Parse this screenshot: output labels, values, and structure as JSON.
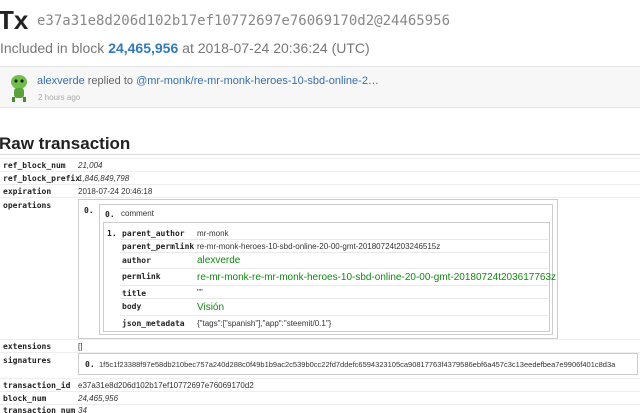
{
  "header": {
    "title": "Tx",
    "hash": "e37a31e8d206d102b17ef10772697e76069170d2",
    "at_sep": "@",
    "block_suffix": "24465956",
    "included_prefix": "Included in block",
    "block_number": "24,465,956",
    "included_at": "at 2018-07-24 20:36:24 (UTC)"
  },
  "activity": {
    "user": "alexverde",
    "action": "replied to",
    "target": "@mr-monk/re-mr-monk-heroes-10-sbd-online-2…",
    "time": "2 hours ago"
  },
  "raw": {
    "section_title": "Raw transaction",
    "ref_block_num_key": "ref_block_num",
    "ref_block_num": "21,004",
    "ref_block_prefix_key": "ref_block_prefix",
    "ref_block_prefix": "1,846,849,798",
    "expiration_key": "expiration",
    "expiration": "2018-07-24 20:46:18",
    "operations_key": "operations",
    "op_index": "0.",
    "op_inner_index": "0.",
    "op_type": "comment",
    "op_data_index": "1.",
    "fields": {
      "parent_author_key": "parent_author",
      "parent_author": "mr-monk",
      "parent_permlink_key": "parent_permlink",
      "parent_permlink": "re-mr-monk-heroes-10-sbd-online-20-00-gmt-20180724t203246515z",
      "author_key": "author",
      "author": "alexverde",
      "permlink_key": "permlink",
      "permlink": "re-mr-monk-re-mr-monk-heroes-10-sbd-online-20-00-gmt-20180724t203617763z",
      "title_key": "title",
      "title": "\"\"",
      "body_key": "body",
      "body": "Visión",
      "json_metadata_key": "json_metadata",
      "json_metadata": "{\"tags\":[\"spanish\"],\"app\":\"steemit/0.1\"}"
    },
    "extensions_key": "extensions",
    "extensions": "[]",
    "signatures_key": "signatures",
    "sig_index": "0.",
    "signature": "1f5c1f23388f97e58db210bec757a240d288c0f49b1b9ac2c539b0cc22fd7ddefc6594323105ca90817763f4379586ebf6a457c3c13eedefbea7e9906f401c8d3a",
    "transaction_id_key": "transaction_id",
    "transaction_id": "e37a31e8d206d102b17ef10772697e76069170d2",
    "block_num_key": "block_num",
    "block_num": "24,465,956",
    "transaction_num_key": "transaction_num",
    "transaction_num": "34"
  },
  "colors": {
    "link": "#337ab7",
    "green_value": "#118811"
  },
  "icons": {
    "avatar": "green-robot-avatar"
  }
}
